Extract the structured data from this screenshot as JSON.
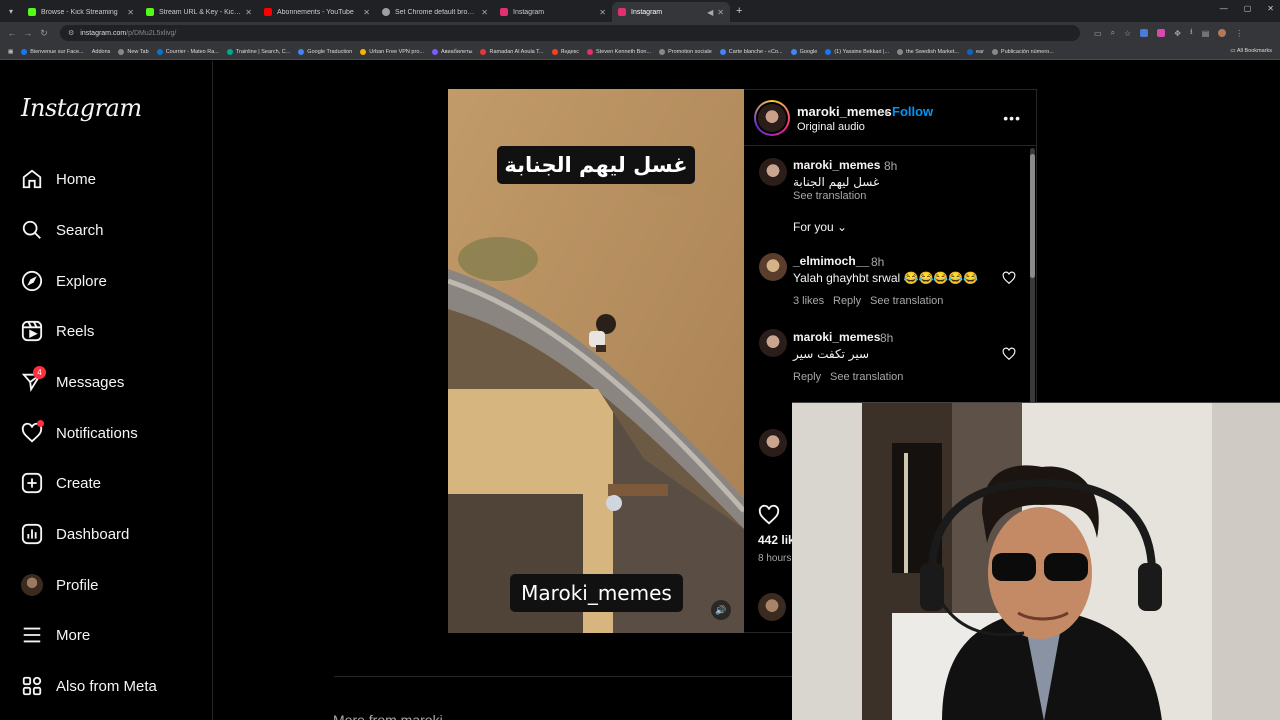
{
  "browser": {
    "tabs": [
      {
        "label": "Browse - Kick Streaming",
        "color": "#53fc18"
      },
      {
        "label": "Stream URL & Key - Kick Dashb",
        "color": "#53fc18"
      },
      {
        "label": "Abonnements - YouTube",
        "color": "#ff0000"
      },
      {
        "label": "Set Chrome default browser",
        "color": "#9aa0a6"
      },
      {
        "label": "Instagram",
        "color": "#e1306c"
      },
      {
        "label": "Instagram",
        "color": "#e1306c"
      }
    ],
    "url_host": "instagram.com",
    "url_path": "/p/DMu2L5xlivg/",
    "bookmarks": [
      {
        "label": "Bienvenue sur Face...",
        "color": "#1877f2"
      },
      {
        "label": "Addons",
        "color": "#888888"
      },
      {
        "label": "New Tab",
        "color": "#888888"
      },
      {
        "label": "Courrier - Mateo Ra...",
        "color": "#0078d4"
      },
      {
        "label": "Trainline | Search, C...",
        "color": "#00a88f"
      },
      {
        "label": "Google Traduction",
        "color": "#4285f4"
      },
      {
        "label": "Urban Free VPN pro...",
        "color": "#f4b400"
      },
      {
        "label": "Авиабилеты",
        "color": "#7a5cff"
      },
      {
        "label": "Ramadan Al Aoula T...",
        "color": "#e53935"
      },
      {
        "label": "Яндекс",
        "color": "#fc3f1d"
      },
      {
        "label": "Steven Kenneth Bon...",
        "color": "#e1306c"
      },
      {
        "label": "Promotion sociale",
        "color": "#888888"
      },
      {
        "label": "Carte blanche - «Co...",
        "color": "#4285f4"
      },
      {
        "label": "Google",
        "color": "#4285f4"
      },
      {
        "label": "(1) Yassine Bekkari |...",
        "color": "#1877f2"
      },
      {
        "label": "the Swedish Market...",
        "color": "#888888"
      },
      {
        "label": "ear",
        "color": "#0a66c2"
      },
      {
        "label": "Publicación número...",
        "color": "#888888"
      }
    ],
    "all_bookmarks": "All Bookmarks"
  },
  "instagram": {
    "logo": "Instagram",
    "nav": [
      {
        "label": "Home",
        "icon": "home-icon"
      },
      {
        "label": "Search",
        "icon": "search-icon"
      },
      {
        "label": "Explore",
        "icon": "compass-icon"
      },
      {
        "label": "Reels",
        "icon": "reels-icon"
      },
      {
        "label": "Messages",
        "icon": "messenger-icon",
        "badge": "4"
      },
      {
        "label": "Notifications",
        "icon": "heart-icon"
      },
      {
        "label": "Create",
        "icon": "plus-square-icon"
      },
      {
        "label": "Dashboard",
        "icon": "chart-icon"
      },
      {
        "label": "Profile",
        "icon": "avatar"
      },
      {
        "label": "More",
        "icon": "menu-icon"
      },
      {
        "label": "Also from Meta",
        "icon": "meta-icon"
      }
    ]
  },
  "post": {
    "caption_top": "غسل ليهم الجنابة",
    "caption_bottom": "Maroki_memes",
    "author": "maroki_memes",
    "follow": "Follow",
    "audio": "Original audio",
    "caption_comment": {
      "user": "maroki_memes",
      "time": "8h",
      "text": "غسل ليهم الجنابة",
      "see_translation": "See translation"
    },
    "sort": "For you",
    "comments": [
      {
        "user": "_elmimoch__",
        "time": "8h",
        "text": "Yalah ghayhbt srwal 😂😂😂😂😂",
        "likes": "3 likes",
        "reply": "Reply",
        "see_translation": "See translation"
      },
      {
        "user": "maroki_memes",
        "time": "8h",
        "text": "سير تكفت سير",
        "reply": "Reply",
        "see_translation": "See translation"
      }
    ],
    "like_count": "442 lik",
    "time_ago": "8 hours",
    "more_from": "More from maroki"
  }
}
